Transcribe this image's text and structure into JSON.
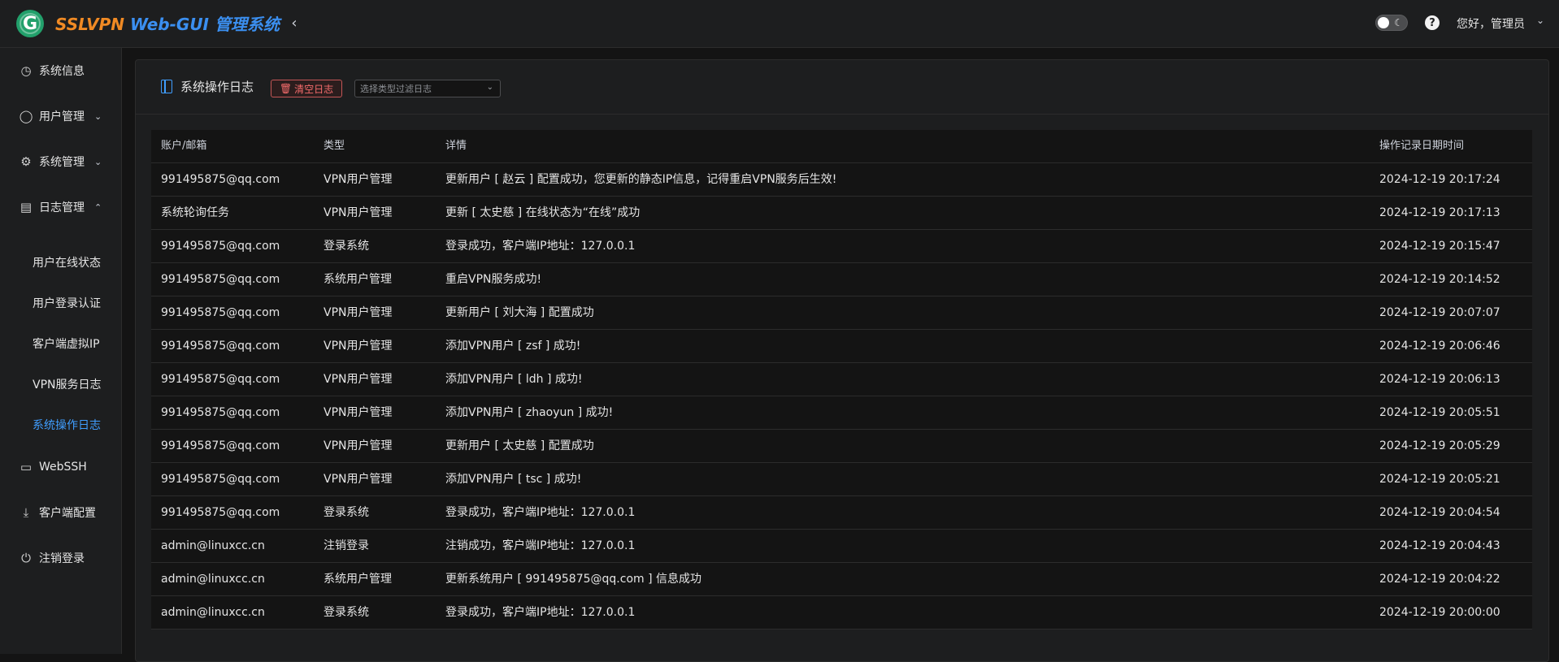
{
  "header": {
    "logo_letter": "G",
    "brand_part1": "SSLVPN",
    "brand_part2": "Web-GUI",
    "brand_part3": "管理系统",
    "greeting": "您好，管理员"
  },
  "sidebar": {
    "items": [
      {
        "label": "系统信息",
        "icon": "dashboard-icon"
      },
      {
        "label": "用户管理",
        "icon": "user-icon"
      },
      {
        "label": "系统管理",
        "icon": "gear-icon"
      },
      {
        "label": "日志管理",
        "icon": "document-icon"
      },
      {
        "label": "WebSSH",
        "icon": "monitor-icon"
      },
      {
        "label": "客户端配置",
        "icon": "download-icon"
      },
      {
        "label": "注销登录",
        "icon": "power-icon"
      }
    ],
    "log_subitems": [
      {
        "label": "用户在线状态"
      },
      {
        "label": "用户登录认证"
      },
      {
        "label": "客户端虚拟IP"
      },
      {
        "label": "VPN服务日志"
      },
      {
        "label": "系统操作日志"
      }
    ]
  },
  "card": {
    "title": "系统操作日志",
    "clear_label": "清空日志",
    "filter_placeholder": "选择类型过滤日志"
  },
  "table": {
    "columns": [
      "账户/邮箱",
      "类型",
      "详情",
      "操作记录日期时间"
    ],
    "rows": [
      [
        "991495875@qq.com",
        "VPN用户管理",
        "更新用户 [ 赵云 ] 配置成功，您更新的静态IP信息，记得重启VPN服务后生效!",
        "2024-12-19 20:17:24"
      ],
      [
        "系统轮询任务",
        "VPN用户管理",
        "更新 [ 太史慈 ] 在线状态为“在线”成功",
        "2024-12-19 20:17:13"
      ],
      [
        "991495875@qq.com",
        "登录系统",
        "登录成功，客户端IP地址：127.0.0.1",
        "2024-12-19 20:15:47"
      ],
      [
        "991495875@qq.com",
        "系统用户管理",
        "重启VPN服务成功!",
        "2024-12-19 20:14:52"
      ],
      [
        "991495875@qq.com",
        "VPN用户管理",
        "更新用户 [ 刘大海 ] 配置成功",
        "2024-12-19 20:07:07"
      ],
      [
        "991495875@qq.com",
        "VPN用户管理",
        "添加VPN用户 [ zsf ] 成功!",
        "2024-12-19 20:06:46"
      ],
      [
        "991495875@qq.com",
        "VPN用户管理",
        "添加VPN用户 [ ldh ] 成功!",
        "2024-12-19 20:06:13"
      ],
      [
        "991495875@qq.com",
        "VPN用户管理",
        "添加VPN用户 [ zhaoyun ] 成功!",
        "2024-12-19 20:05:51"
      ],
      [
        "991495875@qq.com",
        "VPN用户管理",
        "更新用户 [ 太史慈 ] 配置成功",
        "2024-12-19 20:05:29"
      ],
      [
        "991495875@qq.com",
        "VPN用户管理",
        "添加VPN用户 [ tsc ] 成功!",
        "2024-12-19 20:05:21"
      ],
      [
        "991495875@qq.com",
        "登录系统",
        "登录成功，客户端IP地址：127.0.0.1",
        "2024-12-19 20:04:54"
      ],
      [
        "admin@linuxcc.cn",
        "注销登录",
        "注销成功，客户端IP地址：127.0.0.1",
        "2024-12-19 20:04:43"
      ],
      [
        "admin@linuxcc.cn",
        "系统用户管理",
        "更新系统用户 [ 991495875@qq.com ] 信息成功",
        "2024-12-19 20:04:22"
      ],
      [
        "admin@linuxcc.cn",
        "登录系统",
        "登录成功，客户端IP地址：127.0.0.1",
        "2024-12-19 20:00:00"
      ]
    ]
  }
}
